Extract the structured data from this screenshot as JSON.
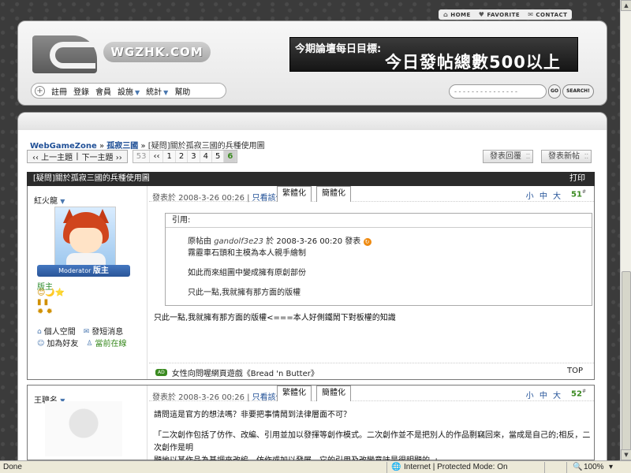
{
  "toplinks": {
    "home": "HOME",
    "favorite": "FAVORITE",
    "contact": "CONTACT"
  },
  "header": {
    "logo_text": "WGZHK.COM",
    "banner_line1": "今期論壇每日目標:",
    "banner_line2": "今日發帖總數500以上"
  },
  "nav": {
    "items": [
      "註冊",
      "登錄",
      "會員",
      "設施",
      "統計",
      "幫助"
    ]
  },
  "search": {
    "placeholder": "- - - - - - - - - - - - - - -",
    "go": "GO",
    "button": "SEARCH!"
  },
  "breadcrumb": {
    "home": "WebGameZone",
    "sep": "»",
    "forum": "孤寂三國",
    "current": "[疑問]關於孤寂三國的兵種使用圖"
  },
  "pager": {
    "prev": "‹‹ 上一主題",
    "sep": "|",
    "next": "下一主題 ››",
    "total": "53",
    "first": "‹‹",
    "pages": [
      "1",
      "2",
      "3",
      "4",
      "5"
    ],
    "current": "6"
  },
  "actions": {
    "reply": "發表回覆",
    "new_topic": "發表新帖"
  },
  "thread": {
    "title": "[疑問]關於孤寂三國的兵種使用圖",
    "print": "打印"
  },
  "post1": {
    "author": "紅火龍",
    "badge_role": "Moderator",
    "badge_title": "版主",
    "group": "版主",
    "medals": "😊🌙⭐",
    "links": {
      "space": "個人空間",
      "pm": "發短消息",
      "friend": "加為好友",
      "online": "當前在線"
    },
    "posted": "發表於 2008-3-26 00:26",
    "only_author": "只看該作者",
    "tab_trad": "繁體化",
    "tab_simp": "簡體化",
    "font_sizes": "小 中 大",
    "floor": "51",
    "floor_mark": "#",
    "quote": {
      "header": "引用:",
      "orig_prefix": "原帖由",
      "orig_user": "gandolf3e23",
      "orig_suffix": "於 2008-3-26 00:20 發表",
      "lines": [
        "霧靂車石頭和主模為本人親手繪制",
        "如此而來組圖中變成擁有原創部份",
        "只此一點,我就擁有那方面的版權"
      ]
    },
    "text": "只此一點,我就擁有那方面的版權<===本人好側鐵鬧下對板權的知識",
    "ad_tag": "AD",
    "ad_text": "女性向問喔網頁遊戲《Bread 'n Butter》",
    "top": "TOP"
  },
  "post2": {
    "author": "王聰名",
    "posted": "發表於 2008-3-26 00:26",
    "only_author": "只看該作者",
    "tab_trad": "繁體化",
    "tab_simp": "簡體化",
    "font_sizes": "小 中 大",
    "floor": "52",
    "floor_mark": "#",
    "line1": "請問這是官方的想法嗎？非要把事情鬧到法律層面不可？",
    "line2": "「二次創作包括了仿作、改編、引用並加以發揮等創作模式。二次創作並不是把別人的作品剽竊回來，當成是自己的;相反，二次創作是明",
    "line3": "顯地以某作品為基調來改編、仿作或加以發展，它的引用及改變意味是很明顯的。」"
  },
  "statusbar": {
    "done": "Done",
    "zone": "Internet | Protected Mode: On",
    "zoom": "100%"
  }
}
